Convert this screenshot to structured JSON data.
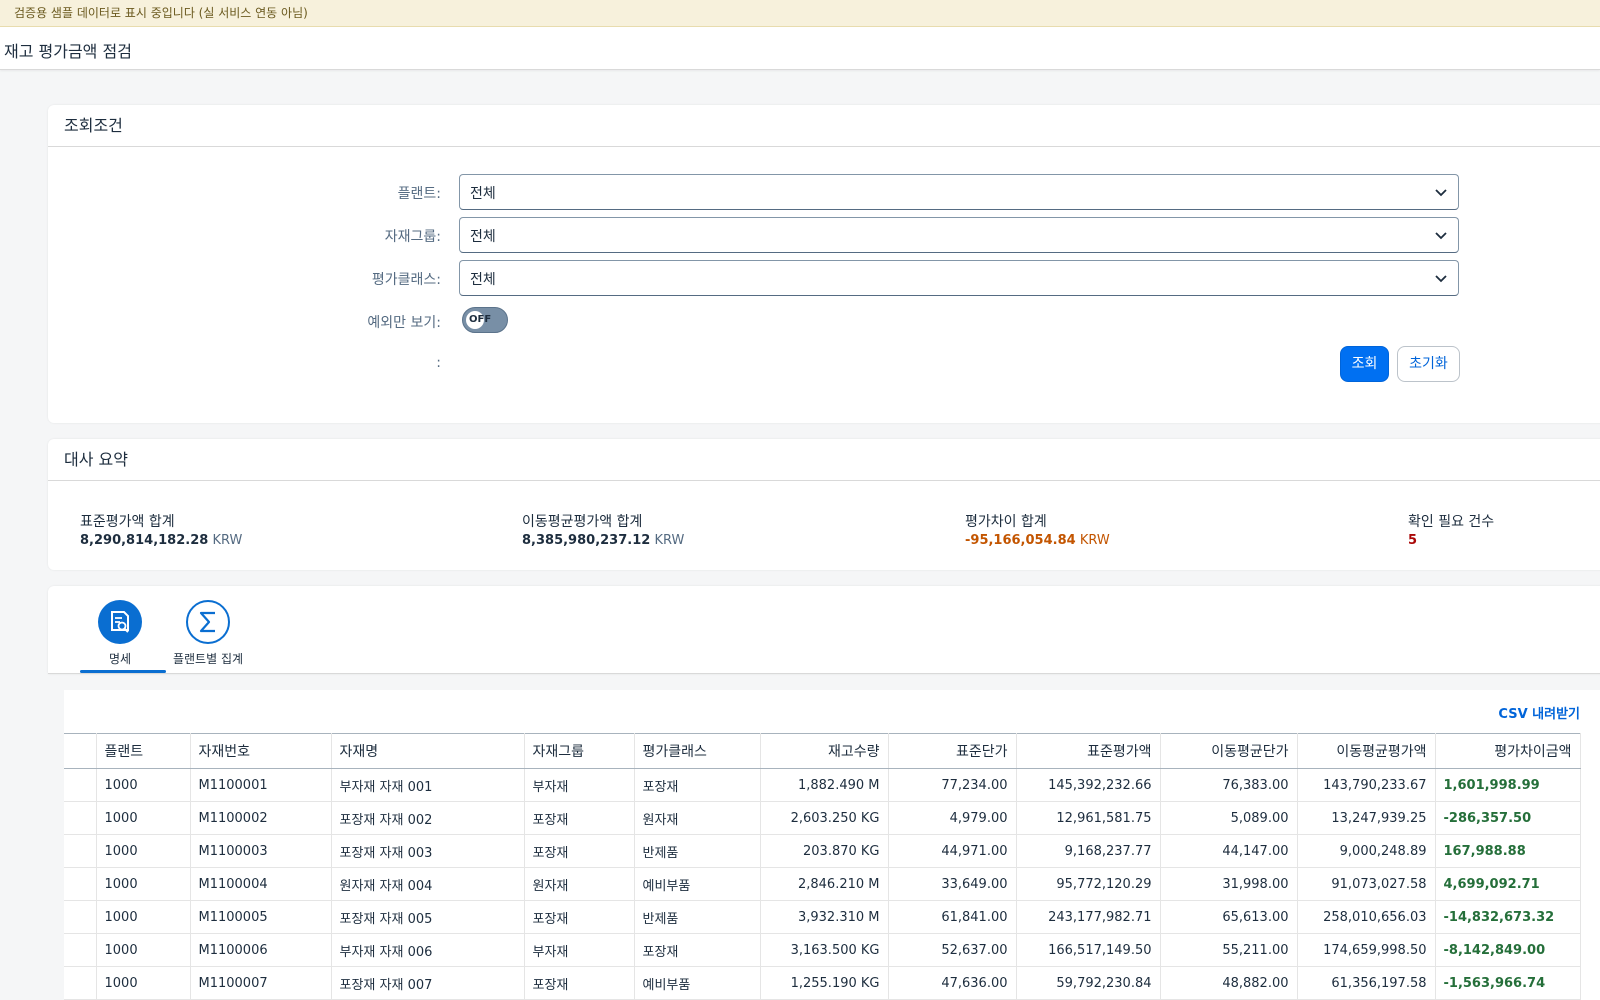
{
  "banner": "검증용 샘플 데이터로 표시 중입니다 (실 서비스 연동 아님)",
  "app_title": "재고 평가금액 점검",
  "filter": {
    "title": "조회조건",
    "plant_label": "플랜트:",
    "plant_value": "전체",
    "group_label": "자재그룹:",
    "group_value": "전체",
    "class_label": "평가클래스:",
    "class_value": "전체",
    "exception_label": "예외만 보기:",
    "toggle_state": "OFF",
    "empty_label": ":",
    "search_button": "조회",
    "reset_button": "초기화"
  },
  "summary": {
    "title": "대사 요약",
    "kpis": [
      {
        "label": "표준평가액 합계",
        "value": "8,290,814,182.28",
        "unit": "KRW"
      },
      {
        "label": "이동평균평가액 합계",
        "value": "8,385,980,237.12",
        "unit": "KRW"
      },
      {
        "label": "평가차이 합계",
        "value": "-95,166,054.84",
        "unit": "KRW"
      },
      {
        "label": "확인 필요 건수",
        "value": "5"
      }
    ]
  },
  "tabs": [
    {
      "label": "명세",
      "icon": "document-search-icon"
    },
    {
      "label": "플랜트별 집계",
      "icon": "sigma-icon"
    }
  ],
  "table": {
    "csv_label": "CSV 내려받기",
    "columns": [
      "플랜트",
      "자재번호",
      "자재명",
      "자재그룹",
      "평가클래스",
      "재고수량",
      "표준단가",
      "표준평가액",
      "이동평균단가",
      "이동평균평가액",
      "평가차이금액"
    ],
    "rows": [
      [
        "1000",
        "M1100001",
        "부자재 자재 001",
        "부자재",
        "포장재",
        "1,882.490 M",
        "77,234.00",
        "145,392,232.66",
        "76,383.00",
        "143,790,233.67",
        "1,601,998.99"
      ],
      [
        "1000",
        "M1100002",
        "포장재 자재 002",
        "포장재",
        "원자재",
        "2,603.250 KG",
        "4,979.00",
        "12,961,581.75",
        "5,089.00",
        "13,247,939.25",
        "-286,357.50"
      ],
      [
        "1000",
        "M1100003",
        "포장재 자재 003",
        "포장재",
        "반제품",
        "203.870 KG",
        "44,971.00",
        "9,168,237.77",
        "44,147.00",
        "9,000,248.89",
        "167,988.88"
      ],
      [
        "1000",
        "M1100004",
        "원자재 자재 004",
        "원자재",
        "예비부품",
        "2,846.210 M",
        "33,649.00",
        "95,772,120.29",
        "31,998.00",
        "91,073,027.58",
        "4,699,092.71"
      ],
      [
        "1000",
        "M1100005",
        "포장재 자재 005",
        "포장재",
        "반제품",
        "3,932.310 M",
        "61,841.00",
        "243,177,982.71",
        "65,613.00",
        "258,010,656.03",
        "-14,832,673.32"
      ],
      [
        "1000",
        "M1100006",
        "부자재 자재 006",
        "부자재",
        "포장재",
        "3,163.500 KG",
        "52,637.00",
        "166,517,149.50",
        "55,211.00",
        "174,659,998.50",
        "-8,142,849.00"
      ],
      [
        "1000",
        "M1100007",
        "포장재 자재 007",
        "포장재",
        "예비부품",
        "1,255.190 KG",
        "47,636.00",
        "59,792,230.84",
        "48,882.00",
        "61,356,197.58",
        "-1,563,966.74"
      ]
    ]
  },
  "colors": {
    "primary": "#0070f2",
    "negative_total": "#c35500",
    "alert_count": "#aa0808",
    "diff_text": "#256f3a"
  }
}
